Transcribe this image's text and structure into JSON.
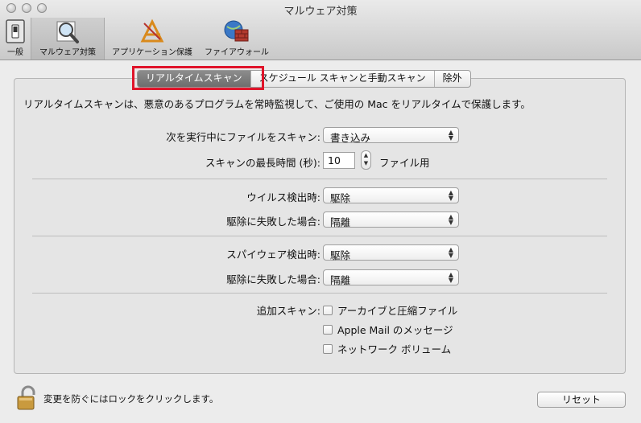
{
  "window": {
    "title": "マルウェア対策"
  },
  "toolbar": {
    "items": [
      {
        "label": "一般",
        "icon": "switch-icon"
      },
      {
        "label": "マルウェア対策",
        "icon": "magnifier-icon",
        "selected": true
      },
      {
        "label": "アプリケーション保護",
        "icon": "app-store-icon"
      },
      {
        "label": "ファイアウォール",
        "icon": "firewall-globe-icon"
      }
    ]
  },
  "tabs": [
    {
      "label": "リアルタイムスキャン",
      "active": true
    },
    {
      "label": "スケジュール スキャンと手動スキャン",
      "active": false
    },
    {
      "label": "除外",
      "active": false
    }
  ],
  "highlight_color": "#e0142a",
  "description": "リアルタイムスキャンは、悪意のあるプログラムを常時監視して、ご使用の Mac をリアルタイムで保護します。",
  "scan_settings": {
    "scan_files_label": "次を実行中にファイルをスキャン:",
    "scan_files_value": "書き込み",
    "max_time_label": "スキャンの最長時間 (秒):",
    "max_time_value": "10",
    "max_time_unit": "ファイル用"
  },
  "virus": {
    "detect_label": "ウイルス検出時:",
    "detect_value": "駆除",
    "fail_label": "駆除に失敗した場合:",
    "fail_value": "隔離"
  },
  "spyware": {
    "detect_label": "スパイウェア検出時:",
    "detect_value": "駆除",
    "fail_label": "駆除に失敗した場合:",
    "fail_value": "隔離"
  },
  "additional": {
    "label": "追加スキャン:",
    "options": [
      {
        "label": "アーカイブと圧縮ファイル",
        "checked": false
      },
      {
        "label": "Apple Mail のメッセージ",
        "checked": false
      },
      {
        "label": "ネットワーク ボリューム",
        "checked": false
      }
    ]
  },
  "footer": {
    "lock_text": "変更を防ぐにはロックをクリックします。",
    "reset_label": "リセット"
  }
}
